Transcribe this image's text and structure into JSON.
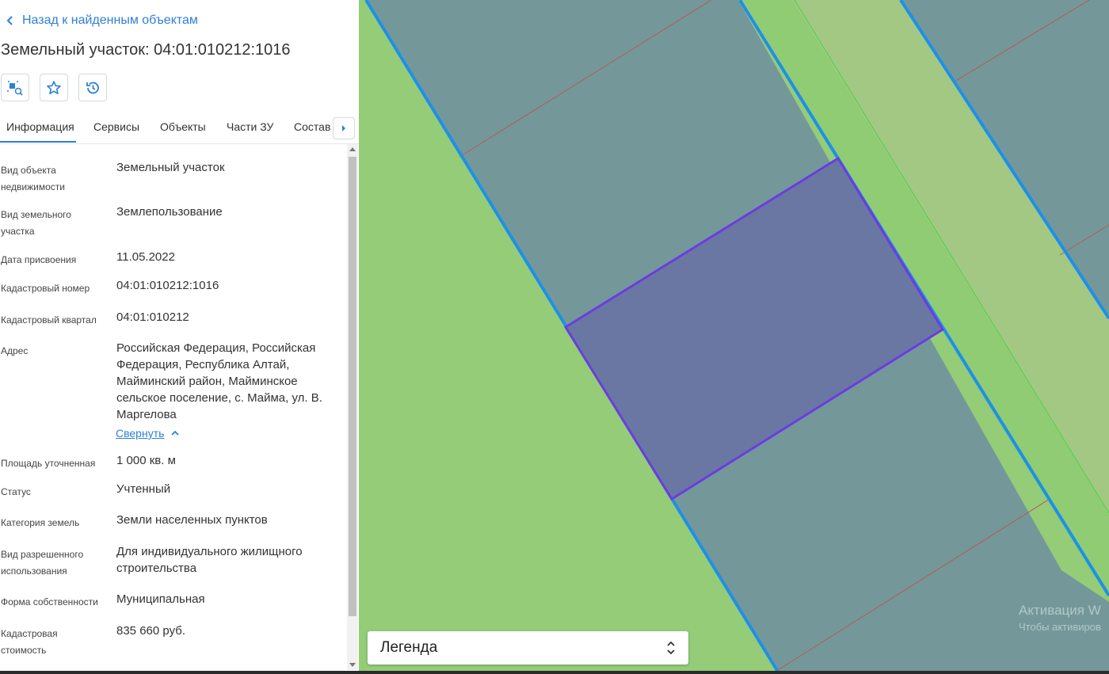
{
  "panel": {
    "back_label": "Назад к найденным объектам",
    "title": "Земельный участок: 04:01:010212:1016",
    "tabs": [
      {
        "label": "Информация"
      },
      {
        "label": "Сервисы"
      },
      {
        "label": "Объекты"
      },
      {
        "label": "Части ЗУ"
      },
      {
        "label": "Состав"
      }
    ],
    "fields": [
      {
        "label": "Вид объекта недвижимости",
        "value": "Земельный участок"
      },
      {
        "label": "Вид земельного участка",
        "value": "Землепользование"
      },
      {
        "label": "Дата присвоения",
        "value": "11.05.2022"
      },
      {
        "label": "Кадастровый номер",
        "value": "04:01:010212:1016"
      },
      {
        "label": "Кадастровый квартал",
        "value": "04:01:010212"
      },
      {
        "label": "Адрес",
        "value": "Российская Федерация, Российская Федерация, Республика Алтай, Майминский район, Майминское сельское поселение, с. Майма, ул. В. Маргелова"
      },
      {
        "label": "Площадь уточненная",
        "value": "1 000 кв. м"
      },
      {
        "label": "Статус",
        "value": "Учтенный"
      },
      {
        "label": "Категория земель",
        "value": "Земли населенных пунктов"
      },
      {
        "label": "Вид разрешенного использования",
        "value": "Для индивидуального жилищного строительства"
      },
      {
        "label": "Форма собственности",
        "value": "Муниципальная"
      },
      {
        "label": "Кадастровая стоимость",
        "value": "835 660 руб."
      }
    ],
    "collapse_label": "Свернуть"
  },
  "map": {
    "legend_label": "Легенда",
    "watermark_title": "Активация W",
    "watermark_sub": "Чтобы активиров",
    "colors": {
      "ground": "#94cc78",
      "parcel": "#74989a",
      "selected_parcel": "#6a77a3",
      "road": "#8fcc74",
      "road_light": "#a3c884",
      "boundary": "#1e90e8",
      "selected_outline": "#6a3de0",
      "inner_line": "#b55a5a"
    }
  },
  "accent": "#2f7fd6"
}
